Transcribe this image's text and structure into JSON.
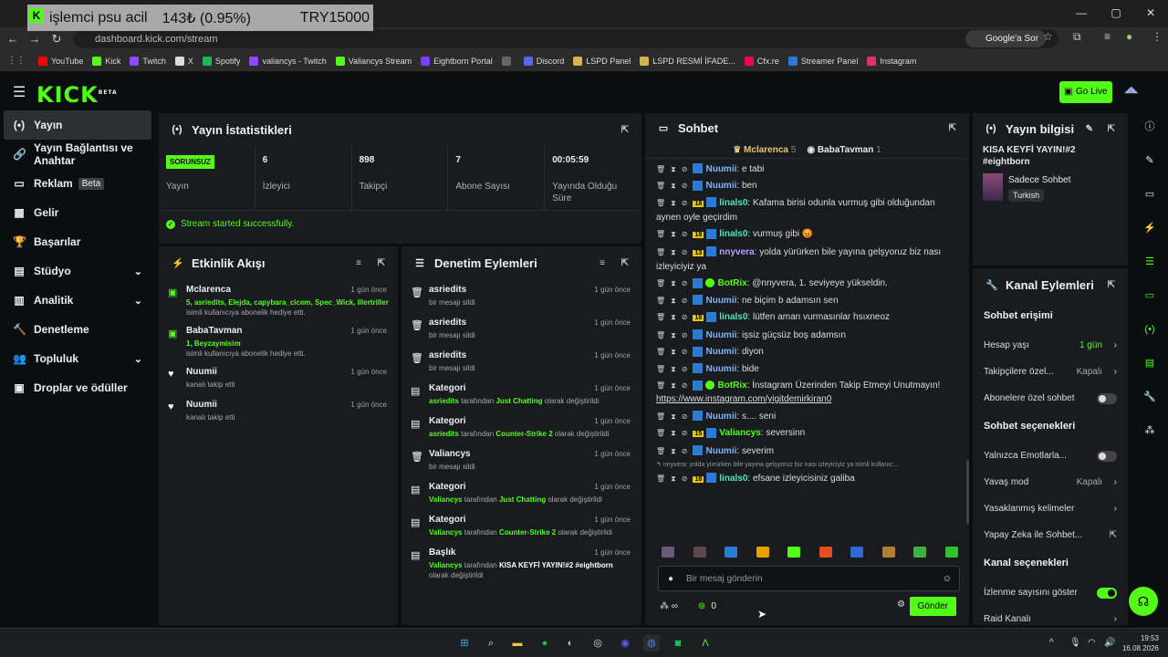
{
  "overlay": {
    "line1": "işlemci psu acil",
    "line2": "143₺ (0.95%)",
    "line3": "TRY15000",
    "tab_close": "×"
  },
  "window": {
    "minimize": "—",
    "maximize": "▢",
    "close": "✕"
  },
  "browser": {
    "url": "dashboard.kick.com/stream",
    "google_btn": "Google'a Sor",
    "back": "←",
    "fwd": "→",
    "reload": "↻"
  },
  "bookmarks": [
    {
      "label": "YouTube",
      "color": "#ff0000"
    },
    {
      "label": "Kick",
      "color": "#53fc18"
    },
    {
      "label": "Twitch",
      "color": "#9146ff"
    },
    {
      "label": "X",
      "color": "#dddddd"
    },
    {
      "label": "Spotify",
      "color": "#1db954"
    },
    {
      "label": "valiancys - Twitch",
      "color": "#9146ff"
    },
    {
      "label": "Valiancys Stream",
      "color": "#53fc18"
    },
    {
      "label": "Eightborn Portal",
      "color": "#7a3cff"
    },
    {
      "label": "",
      "color": "#666666"
    },
    {
      "label": "Discord",
      "color": "#5865f2"
    },
    {
      "label": "LSPD Panel",
      "color": "#d8b24a"
    },
    {
      "label": "LSPD  RESMİ İFADE...",
      "color": "#d8b24a"
    },
    {
      "label": "Cfx.re",
      "color": "#f40552"
    },
    {
      "label": "Streamer Panel",
      "color": "#2a7bd4"
    },
    {
      "label": "Instagram",
      "color": "#e1306c"
    }
  ],
  "kick": {
    "logo": "KICK",
    "beta": "BETA",
    "go_live": "Go Live"
  },
  "sidebar": [
    {
      "label": "Yayın",
      "icon": "(•)",
      "active": true
    },
    {
      "label": "Yayın Bağlantısı ve Anahtar",
      "icon": "🔗"
    },
    {
      "label": "Reklam",
      "icon": "▭",
      "beta": "Beta"
    },
    {
      "label": "Gelir",
      "icon": "▦"
    },
    {
      "label": "Başarılar",
      "icon": "🏆"
    },
    {
      "label": "Stüdyo",
      "icon": "▤",
      "chev": "⌄"
    },
    {
      "label": "Analitik",
      "icon": "▥",
      "chev": "⌄"
    },
    {
      "label": "Denetleme",
      "icon": "🔨"
    },
    {
      "label": "Topluluk",
      "icon": "👥",
      "chev": "⌄"
    },
    {
      "label": "Droplar ve ödüller",
      "icon": "▣"
    }
  ],
  "stats_panel": {
    "title": "Yayın İstatistikleri",
    "status": "SORUNSUZ",
    "status_label": "Yayın",
    "items": [
      {
        "v": "6",
        "l": "İzleyici"
      },
      {
        "v": "898",
        "l": "Takipçi"
      },
      {
        "v": "7",
        "l": "Abone Sayısı"
      },
      {
        "v": "00:05:59",
        "l": "Yayında Olduğu Süre"
      }
    ],
    "success": "Stream started successfully."
  },
  "activity": {
    "title": "Etkinlik Akışı",
    "rows": [
      {
        "name": "Mclarenca",
        "time": "1 gün önce",
        "green": "5, asriedits, Elejda, capybara_cicem, Spec_Wick, illertriller",
        "text": "isimli kullanıcıya abonelik hediye etti."
      },
      {
        "name": "BabaTavman",
        "time": "1 gün önce",
        "green": "1, Beyzaymisim",
        "text": "isimli kullanıcıya abonelik hediye etti."
      },
      {
        "name": "Nuumii",
        "time": "1 gün önce",
        "green": "",
        "text": "kanalı takip etti"
      },
      {
        "name": "Nuumii",
        "time": "1 gün önce",
        "green": "",
        "text": "kanalı takip etti"
      }
    ]
  },
  "moderation": {
    "title": "Denetim Eylemleri",
    "rows": [
      {
        "name": "asriedits",
        "time": "1 gün önce",
        "desc": "bir mesajı sildi"
      },
      {
        "name": "asriedits",
        "time": "1 gün önce",
        "desc": "bir mesajı sildi"
      },
      {
        "name": "asriedits",
        "time": "1 gün önce",
        "desc": "bir mesajı sildi"
      },
      {
        "name": "Kategori",
        "time": "1 gün önce",
        "u": "asriedits",
        "mid": "tarafından",
        "cat": "Just Chatting",
        "end": "olarak değiştirildi"
      },
      {
        "name": "Kategori",
        "time": "1 gün önce",
        "u": "asriedits",
        "mid": "tarafından",
        "cat": "Counter-Strike 2",
        "end": "olarak değiştirildi"
      },
      {
        "name": "Valiancys",
        "time": "1 gün önce",
        "desc": "bir mesajı sildi"
      },
      {
        "name": "Kategori",
        "time": "1 gün önce",
        "u": "Valiancys",
        "mid": "tarafından",
        "cat": "Just Chatting",
        "end": "olarak değiştirildi"
      },
      {
        "name": "Kategori",
        "time": "1 gün önce",
        "u": "Valiancys",
        "mid": "tarafından",
        "cat": "Counter-Strike 2",
        "end": "olarak değiştirildi"
      },
      {
        "name": "Başlık",
        "time": "1 gün önce",
        "u": "Valiancys",
        "mid": "tarafından",
        "cat": "KISA KEYFİ YAYIN!#2 #eightborn",
        "end": "olarak değiştirildi"
      }
    ]
  },
  "chat": {
    "title": "Sohbet",
    "top1": "Mclarenca",
    "top1n": "5",
    "top2": "BabaTavman",
    "top2n": "1",
    "messages": [
      {
        "lvl": "",
        "user": "Nuumii",
        "cls": "nu",
        "text": "e tabi"
      },
      {
        "lvl": "",
        "user": "Nuumii",
        "cls": "nu",
        "text": "ben"
      },
      {
        "lvl": "18",
        "user": "linals0",
        "cls": "li",
        "text": "Kafama birisi odunla vurmuş gibi olduğundan aynen oyle geçirdim"
      },
      {
        "lvl": "18",
        "user": "linals0",
        "cls": "li",
        "text": "vurmuş gibi 😡"
      },
      {
        "lvl": "13",
        "user": "nnyvera",
        "cls": "ny",
        "text": "yolda yürürken bile yayına gelşyoruz biz nası izleyiciyiz ya"
      },
      {
        "lvl": "",
        "user": "BotRix",
        "cls": "bot",
        "text": "@nnyvera, 1. seviyeye yükseldin."
      },
      {
        "lvl": "",
        "user": "Nuumii",
        "cls": "nu",
        "text": "ne biçim b adamsın sen"
      },
      {
        "lvl": "18",
        "user": "linals0",
        "cls": "li",
        "text": "lütfen aman vurmasınlar hsıxneoz"
      },
      {
        "lvl": "",
        "user": "Nuumii",
        "cls": "nu",
        "text": "işsiz güçsüz boş adamsın"
      },
      {
        "lvl": "",
        "user": "Nuumii",
        "cls": "nu",
        "text": "diyon"
      },
      {
        "lvl": "",
        "user": "Nuumii",
        "cls": "nu",
        "text": "bide"
      },
      {
        "lvl": "",
        "user": "BotRix",
        "cls": "bot",
        "text": "İnstagram Üzerinden Takip Etmeyi Unutmayın!",
        "link": "https://www.instagram.com/yigitdemirkiran0"
      },
      {
        "lvl": "",
        "user": "Nuumii",
        "cls": "nu",
        "text": "s.... seni"
      },
      {
        "lvl": "15",
        "user": "Valiancys",
        "cls": "va",
        "text": "seversinn"
      },
      {
        "lvl": "",
        "user": "Nuumii",
        "cls": "nu",
        "text": "severim"
      },
      {
        "lvl": "18",
        "user": "linals0",
        "cls": "li",
        "text": "efsane izleyicisiniz galiba",
        "reply": "nnyvera: yolda yürürken bile yayına gelşyoruz biz nası izleyiciyiz ya isimli kullanıc..."
      }
    ],
    "input_placeholder": "Bir mesaj gönderin",
    "count": "0",
    "send": "Gönder"
  },
  "stream_info": {
    "title": "Yayın bilgisi",
    "stream_title": "KISA KEYFİ YAYIN!#2 #eightborn",
    "category": "Sadece Sohbet",
    "lang": "Turkish"
  },
  "channel_actions": {
    "title": "Kanal Eylemleri",
    "chat_access": "Sohbet erişimi",
    "rows1": [
      {
        "l": "Hesap yaşı",
        "v": "1 gün",
        "g": true
      },
      {
        "l": "Takipçilere özel...",
        "v": "Kapalı"
      },
      {
        "l": "Abonelere özel sohbet",
        "toggle": false
      }
    ],
    "chat_options": "Sohbet seçenekleri",
    "rows2": [
      {
        "l": "Yalnızca Emotlarla...",
        "toggle": false
      },
      {
        "l": "Yavaş mod",
        "v": "Kapalı"
      },
      {
        "l": "Yasaklanmış kelimeler",
        "v": ""
      },
      {
        "l": "Yapay Zeka ile Sohbet...",
        "ext": true
      }
    ],
    "channel_options": "Kanal seçenekleri",
    "rows3": [
      {
        "l": "İzlenme sayısını göster",
        "toggle": true
      },
      {
        "l": "Raid Kanalı",
        "v": ""
      }
    ]
  },
  "taskbar": {
    "time": "19:53",
    "date": "16.08.2026"
  }
}
